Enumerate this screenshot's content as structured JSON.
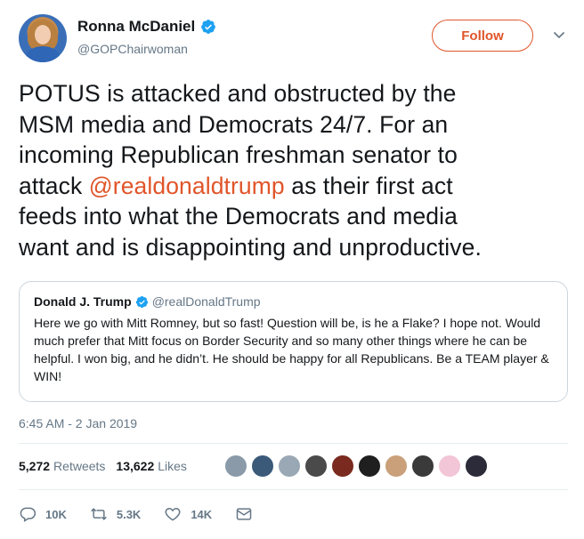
{
  "author": {
    "display_name": "Ronna McDaniel",
    "handle": "@GOPChairwoman",
    "verified": true,
    "avatar_icon": "profile-photo"
  },
  "follow_label": "Follow",
  "tweet": {
    "lines": [
      "POTUS is attacked and obstructed by the",
      "MSM media and Democrats 24/7. For an",
      "incoming Republican freshman senator to"
    ],
    "line4_before": "attack ",
    "line4_mention": "@realdonaldtrump",
    "line4_after": " as their first act",
    "lines_end": [
      "feeds into what the Democrats and media",
      "want and is disappointing and unproductive."
    ]
  },
  "quoted_tweet": {
    "display_name": "Donald J. Trump",
    "handle": "@realDonaldTrump",
    "verified": true,
    "text": "Here we go with Mitt Romney, but so fast! Question will be, is he a Flake? I hope not. Would much prefer that Mitt focus on Border Security and so many other things where he can be helpful. I won big, and he didn’t. He should be happy for all Republicans. Be a TEAM player & WIN!"
  },
  "timestamp": "6:45 AM - 2 Jan 2019",
  "stats": {
    "retweets_count": "5,272",
    "retweets_label": "Retweets",
    "likes_count": "13,622",
    "likes_label": "Likes"
  },
  "likers": [
    "#8a9aa8",
    "#3b5a7a",
    "#9aa8b5",
    "#4a4a4a",
    "#7a2a1e",
    "#1f1f1f",
    "#c9a07a",
    "#3a3a3a",
    "#f2c6d6",
    "#2b2b3a"
  ],
  "actions": {
    "reply_count": "10K",
    "retweet_count": "5.3K",
    "like_count": "14K"
  },
  "colors": {
    "accent": "#e0552a",
    "verified": "#1da1f2",
    "muted": "#657786"
  }
}
